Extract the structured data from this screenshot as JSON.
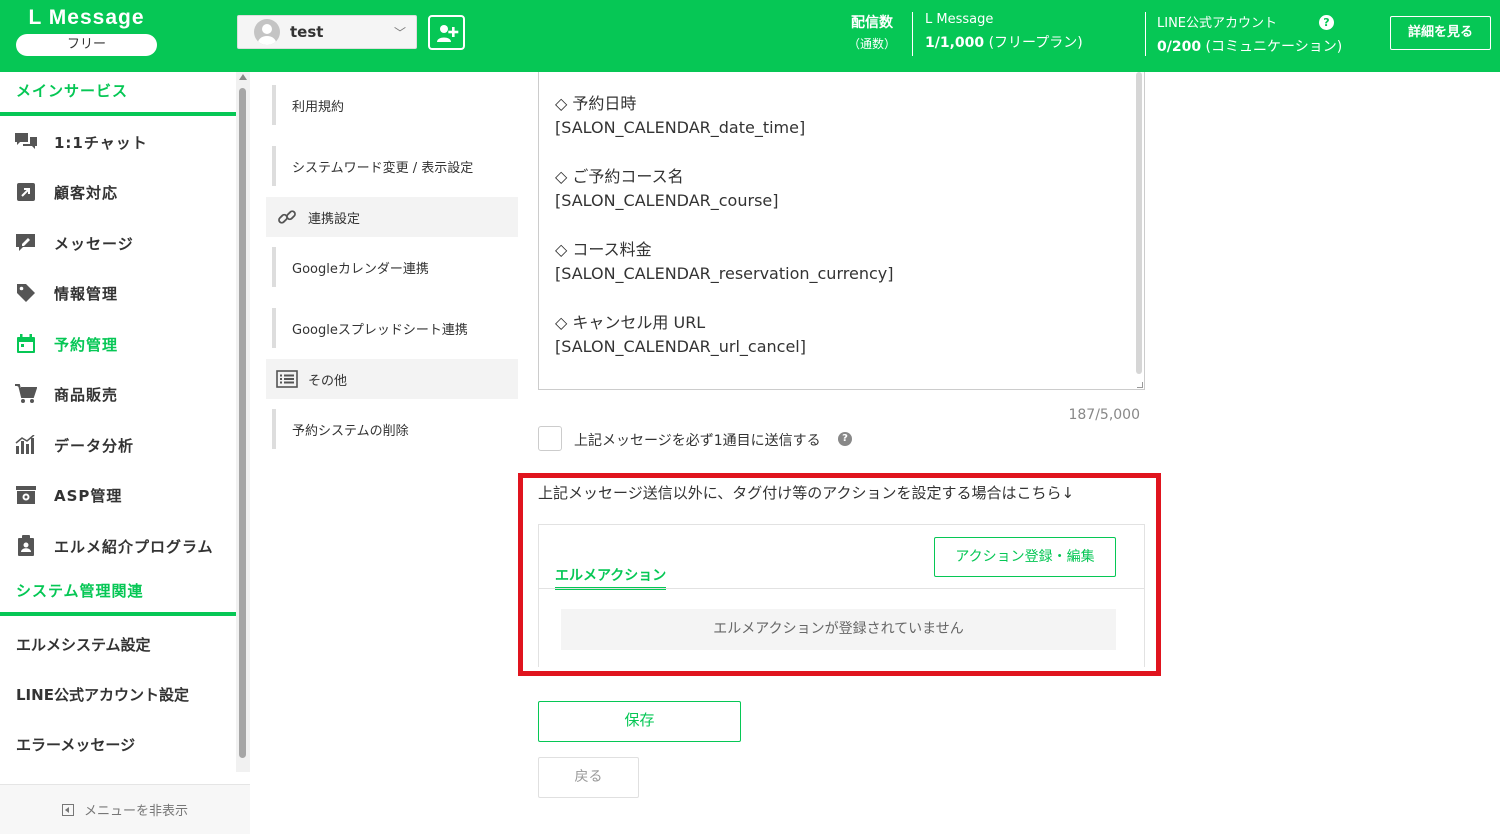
{
  "header": {
    "logo": "L Message",
    "plan": "フリー",
    "account": {
      "name": "test"
    },
    "delivery": {
      "label": "配信数",
      "sublabel": "（通数）"
    },
    "lmessage_stat": {
      "title": "L Message",
      "value": "1/1,000",
      "note": "(フリープラン)"
    },
    "line_stat": {
      "title": "LINE公式アカウント",
      "value": "0/200",
      "note": "(コミュニケーション)"
    },
    "details_button": "詳細を見る"
  },
  "sidebar": {
    "main_section": "メインサービス",
    "items": [
      {
        "label": "1:1チャット",
        "icon": "chat-icon"
      },
      {
        "label": "顧客対応",
        "icon": "arrow-box-icon"
      },
      {
        "label": "メッセージ",
        "icon": "message-edit-icon"
      },
      {
        "label": "情報管理",
        "icon": "tag-icon"
      },
      {
        "label": "予約管理",
        "icon": "calendar-icon",
        "active": true
      },
      {
        "label": "商品販売",
        "icon": "cart-icon"
      },
      {
        "label": "データ分析",
        "icon": "bar-chart-icon"
      },
      {
        "label": "ASP管理",
        "icon": "asp-icon"
      },
      {
        "label": "エルメ紹介プログラム",
        "icon": "clipboard-icon"
      }
    ],
    "system_section": "システム管理関連",
    "system_items": [
      "エルメシステム設定",
      "LINE公式アカウント設定",
      "エラーメッセージ"
    ],
    "footer": "メニューを非表示"
  },
  "submenu": {
    "items": [
      {
        "label": "利用規約"
      },
      {
        "label": "システムワード変更 / 表示設定"
      },
      {
        "label": "連携設定",
        "group": true,
        "icon": "link-icon"
      },
      {
        "label": "Googleカレンダー連携"
      },
      {
        "label": "Googleスプレッドシート連携"
      },
      {
        "label": "その他",
        "group": true,
        "icon": "list-icon"
      },
      {
        "label": "予約システムの削除"
      }
    ]
  },
  "main": {
    "message_lines": [
      "◇ 予約日時",
      "[SALON_CALENDAR_date_time]",
      "◇ ご予約コース名",
      "[SALON_CALENDAR_course]",
      "◇ コース料金",
      "[SALON_CALENDAR_reservation_currency]",
      "◇ キャンセル用 URL",
      "[SALON_CALENDAR_url_cancel]"
    ],
    "char_count": "187/5,000",
    "checkbox_label": "上記メッセージを必ず1通目に送信する",
    "action_note": "上記メッセージ送信以外に、タグ付け等のアクションを設定する場合はこちら↓",
    "action_tab": "エルメアクション",
    "action_button": "アクション登録・編集",
    "action_empty": "エルメアクションが登録されていません",
    "save_button": "保存",
    "back_button": "戻る"
  },
  "colors": {
    "brand": "#06c755",
    "highlight": "#e0141e"
  }
}
